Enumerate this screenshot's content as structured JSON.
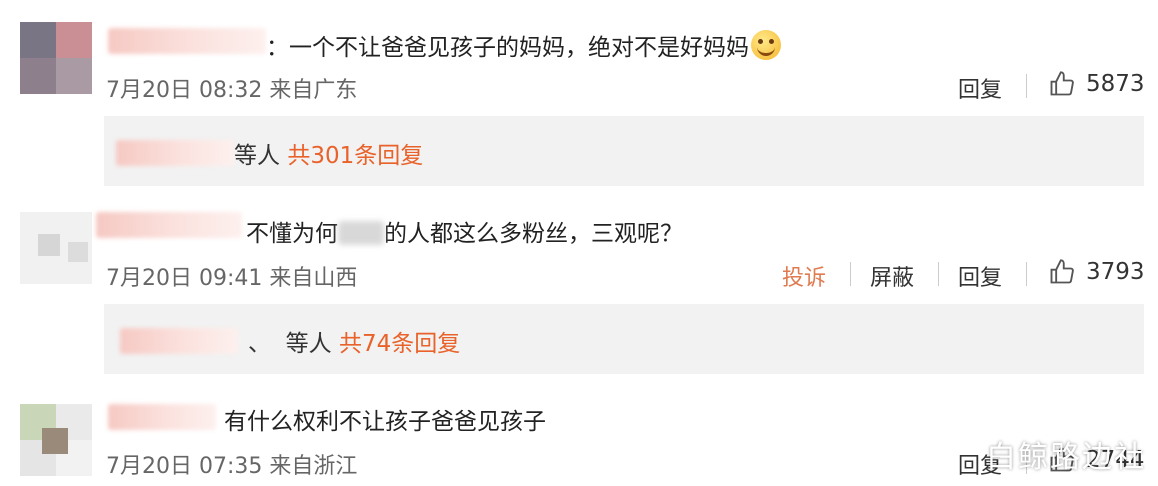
{
  "comments": [
    {
      "text": "：一个不让爸爸见孩子的妈妈，绝对不是好妈妈",
      "emoji": "smirk-emoji",
      "meta": "7月20日 08:32 来自广东",
      "reply_label": "回复",
      "likes": "5873",
      "thread": {
        "suffix": "等人",
        "count_text": "共301条回复"
      }
    },
    {
      "text_before": "不懂为何",
      "text_after": "的人都这么多粉丝，三观呢？",
      "meta": "7月20日 09:41 来自山西",
      "report_label": "投诉",
      "block_label": "屏蔽",
      "reply_label": "回复",
      "likes": "3793",
      "thread": {
        "prefix": "、",
        "suffix": "等人",
        "count_text": "共74条回复"
      }
    },
    {
      "text": "有什么权利不让孩子爸爸见孩子",
      "meta": "7月20日 07:35 来自浙江",
      "reply_label": "回复",
      "likes": "2744"
    }
  ],
  "watermark": "白鲸路边社",
  "colors": {
    "accent": "#e8622a",
    "report": "#e07a4f",
    "reply_bg": "#f2f2f2"
  },
  "icons": {
    "like": "thumbs-up-icon"
  }
}
